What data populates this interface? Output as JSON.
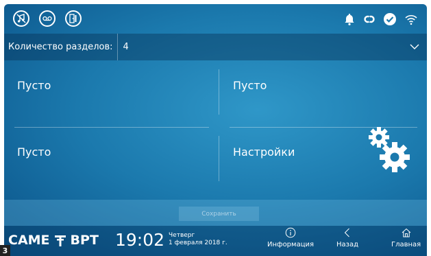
{
  "statusbar": {
    "left_icons": [
      "music-off-icon",
      "voicemail-icon",
      "door-icon"
    ],
    "right_icons": [
      "bell-icon",
      "link-icon",
      "check-circle-icon",
      "wifi-icon"
    ]
  },
  "sections": {
    "label": "Количество разделов:",
    "value": "4"
  },
  "tiles": [
    {
      "label": "Пусто"
    },
    {
      "label": "Пусто"
    },
    {
      "label": "Пусто"
    },
    {
      "label": "Настройки"
    }
  ],
  "save": {
    "label": "Сохранить"
  },
  "footer": {
    "brand_left": "CAME",
    "brand_right": "BPT",
    "time": "19:02",
    "weekday": "Четверг",
    "date": "1 февраля 2018 г.",
    "nav": [
      {
        "label": "Информация",
        "icon": "info-icon"
      },
      {
        "label": "Назад",
        "icon": "back-icon"
      },
      {
        "label": "Главная",
        "icon": "home-icon"
      }
    ]
  },
  "badge": "3",
  "colors": {
    "bg_light": "#2f97c8",
    "bg_dark": "#0a4f83",
    "text": "#ffffff"
  }
}
